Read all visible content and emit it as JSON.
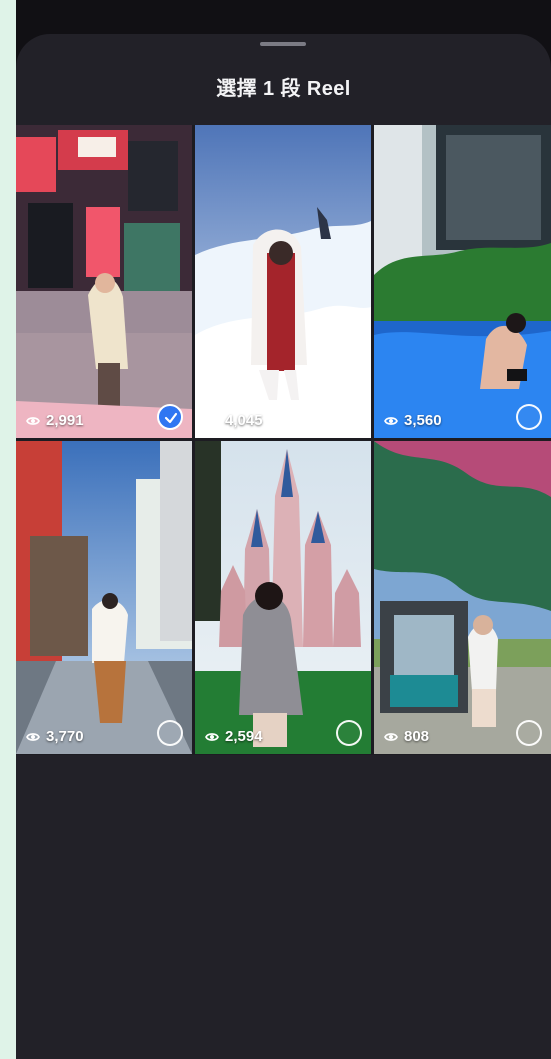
{
  "colors": {
    "outer_background": "#dff3e8",
    "sheet_background": "#222128",
    "selected_accent": "#2f76f2"
  },
  "sheet": {
    "title": "選擇 1 段 Reel"
  },
  "reels": [
    {
      "views": "2,991",
      "selected": true,
      "scene": "city-night-street",
      "icon": "eye-icon"
    },
    {
      "views": "4,045",
      "selected": false,
      "scene": "snow-mountain",
      "icon": "eye-icon"
    },
    {
      "views": "3,560",
      "selected": false,
      "scene": "pool-resort",
      "icon": "eye-icon"
    },
    {
      "views": "3,770",
      "selected": false,
      "scene": "sunny-city-street",
      "icon": "eye-icon"
    },
    {
      "views": "2,594",
      "selected": false,
      "scene": "castle-park",
      "icon": "eye-icon"
    },
    {
      "views": "808",
      "selected": false,
      "scene": "golf-course",
      "icon": "eye-icon"
    }
  ]
}
